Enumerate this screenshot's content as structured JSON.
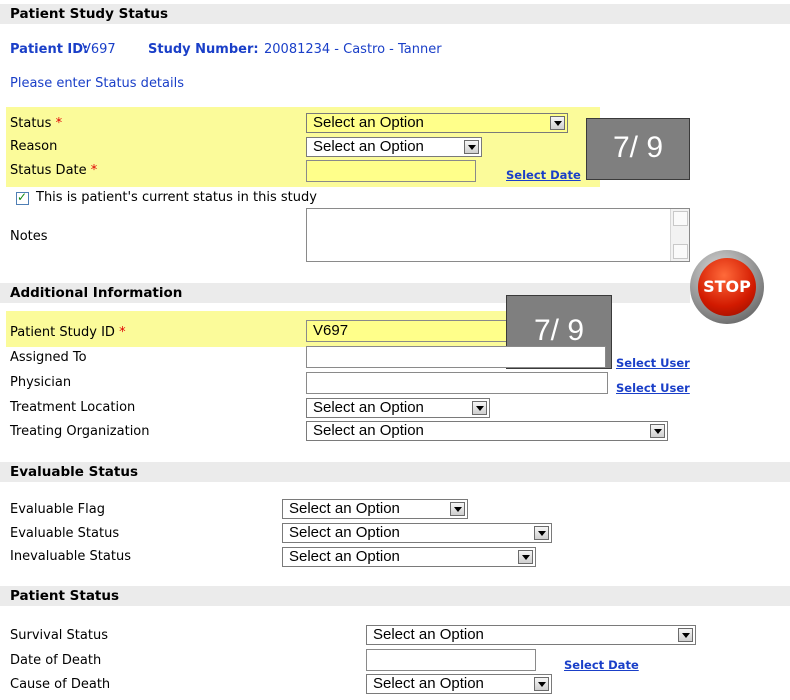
{
  "sections": {
    "patient_study_status": "Patient Study Status",
    "additional_information": "Additional Information",
    "evaluable_status": "Evaluable Status",
    "patient_status": "Patient Status"
  },
  "header": {
    "patient_id_label": "Patient ID:",
    "patient_id_value": "V697",
    "study_number_label": "Study Number:",
    "study_number_value": "20081234 - Castro - Tanner",
    "instruction": "Please enter Status details"
  },
  "status_form": {
    "status_label": "Status",
    "reason_label": "Reason",
    "status_date_label": "Status Date",
    "required_mark": "*",
    "status_value": "Select an Option",
    "reason_value": "Select an Option",
    "status_date_value": "",
    "select_date_link": "Select Date",
    "current_status_label": "This is patient's current status in this study",
    "notes_label": "Notes"
  },
  "overlays": {
    "first": "7/ 9",
    "second": "7/ 9"
  },
  "stop_sign": "STOP",
  "additional": {
    "patient_study_id_label": "Patient Study ID",
    "patient_study_id_value": "V697",
    "assigned_to_label": "Assigned To",
    "physician_label": "Physician",
    "select_user_link": "Select User",
    "treatment_location_label": "Treatment Location",
    "treatment_location_value": "Select an Option",
    "treating_org_label": "Treating Organization",
    "treating_org_value": "Select an Option"
  },
  "evaluable": {
    "flag_label": "Evaluable Flag",
    "flag_value": "Select an Option",
    "status_label": "Evaluable Status",
    "status_value": "Select an Option",
    "inevaluable_label": "Inevaluable Status",
    "inevaluable_value": "Select an Option"
  },
  "patient_status": {
    "survival_label": "Survival Status",
    "survival_value": "Select an Option",
    "death_date_label": "Date of Death",
    "select_date_link": "Select Date",
    "cause_label": "Cause of Death",
    "cause_value": "Select an Option"
  }
}
